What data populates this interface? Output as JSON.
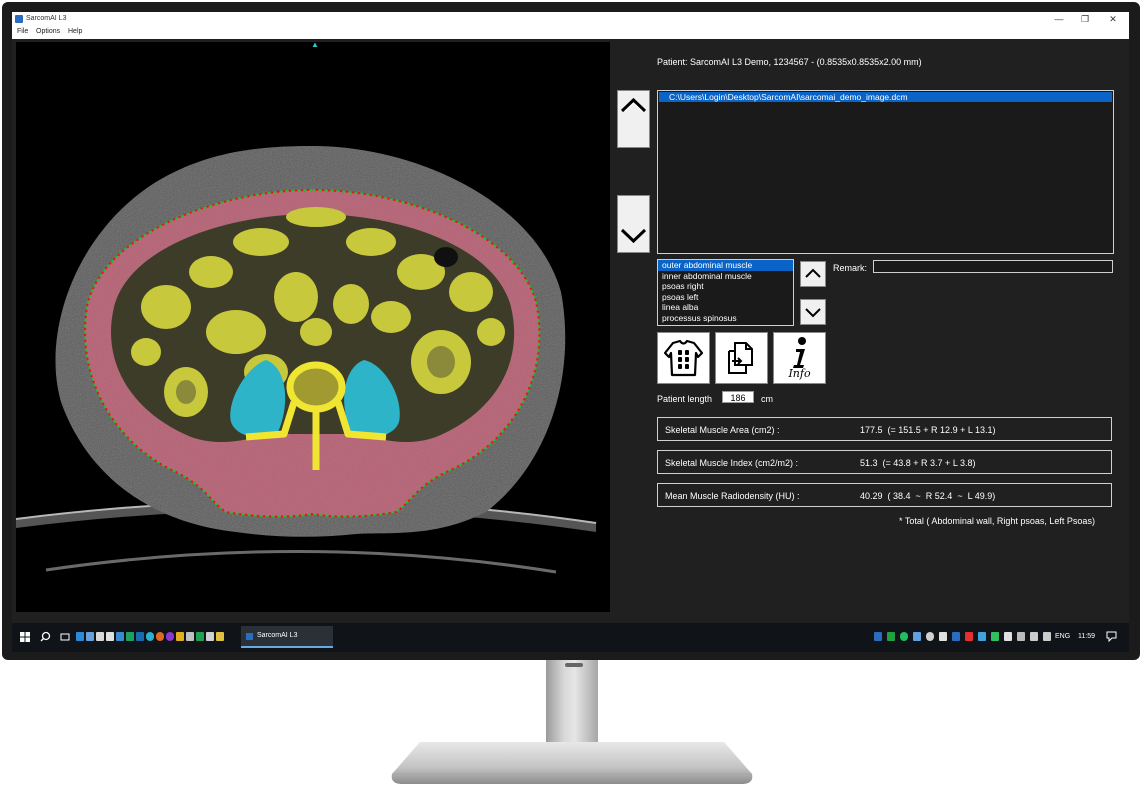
{
  "window": {
    "title": "SarcomAI L3",
    "menus": [
      "File",
      "Options",
      "Help"
    ],
    "controls": {
      "minimize": "—",
      "maximize": "❐",
      "close": "✕"
    }
  },
  "patient": {
    "info": "Patient: SarcomAI L3 Demo, 1234567 - (0.8535x0.8535x2.00 mm)",
    "length_label": "Patient length",
    "length_value": "186",
    "length_unit": "cm"
  },
  "files": {
    "items": [
      "C:\\Users\\Login\\Desktop\\SarcomAI\\sarcomai_demo_image.dcm"
    ],
    "selected": 0
  },
  "muscles": {
    "items": [
      "outer abdominal muscle",
      "inner abdominal muscle",
      "psoas right",
      "psoas left",
      "linea alba",
      "processus spinosus"
    ],
    "selected": 0
  },
  "remark": {
    "label": "Remark:",
    "value": ""
  },
  "tools": {
    "body_icon": "torso-muscle-icon",
    "copy_icon": "copy-pages-icon",
    "info_icon": "info-icon",
    "info_label": "Info"
  },
  "results": [
    {
      "label": "Skeletal Muscle Area (cm2) :",
      "value": "177.5  (= 151.5 + R 12.9 + L 13.1)"
    },
    {
      "label": "Skeletal Muscle Index (cm2/m2) :",
      "value": "51.3  (= 43.8 + R 3.7 + L 3.8)"
    },
    {
      "label": "Mean Muscle Radiodensity (HU) :",
      "value": "40.29  ( 38.4  ~  R 52.4  ~  L 49.9)"
    }
  ],
  "footnote": "* Total ( Abdominal wall, Right psoas, Left Psoas)",
  "taskbar": {
    "app_label": "SarcomAI L3",
    "language": "ENG",
    "time": "11:59"
  },
  "colors": {
    "selection": "#0a64c8",
    "muscle_mask": "#b45a6e",
    "psoas_mask": "#2eb4c8",
    "bowel_fat": "#c8c83c",
    "spine": "#f0e632",
    "contour_red": "#e01818",
    "contour_green": "#18c818"
  }
}
